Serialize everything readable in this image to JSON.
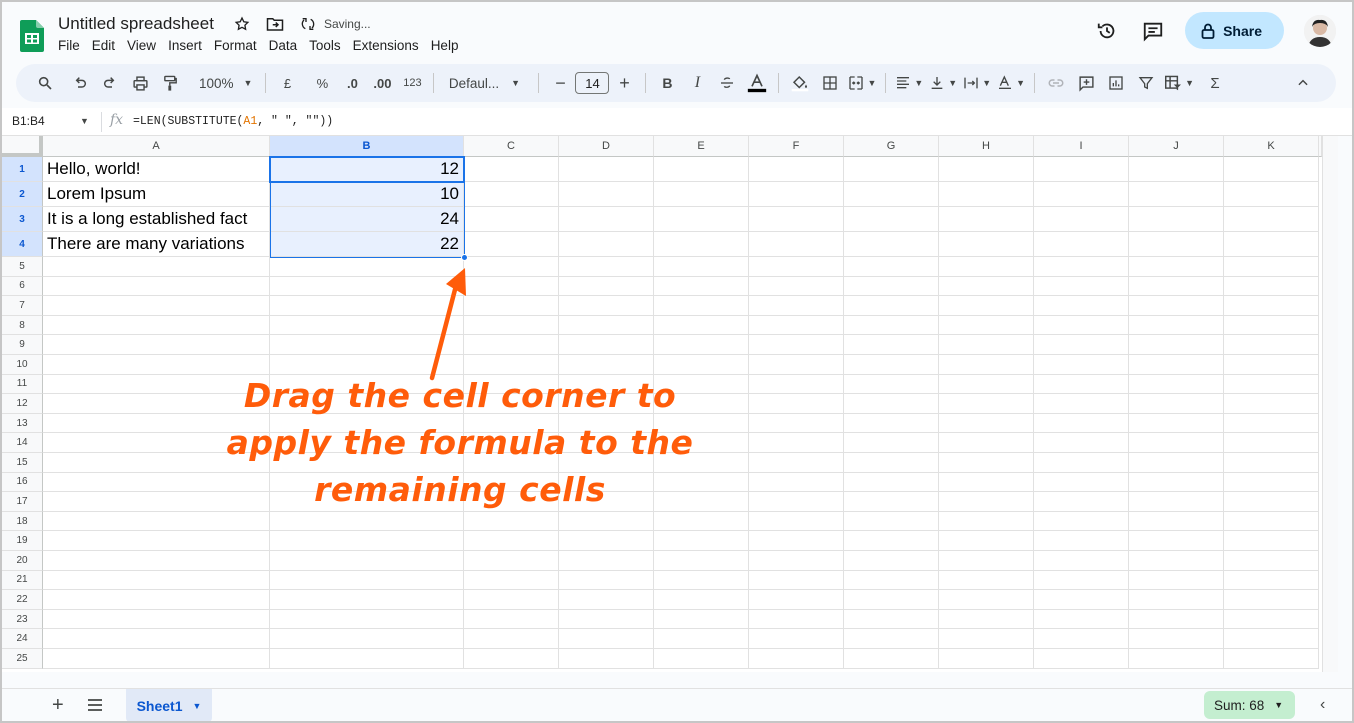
{
  "doc": {
    "title": "Untitled spreadsheet",
    "status": "Saving..."
  },
  "menu": [
    "File",
    "Edit",
    "View",
    "Insert",
    "Format",
    "Data",
    "Tools",
    "Extensions",
    "Help"
  ],
  "header": {
    "share_label": "Share"
  },
  "toolbar": {
    "zoom": "100%",
    "currency": "£",
    "percent": "%",
    "dec_decrease": ".0",
    "dec_increase": ".00",
    "number_format": "123",
    "font": "Defaul...",
    "font_size": "14",
    "bold": "B",
    "italic": "I",
    "sum_symbol": "Σ"
  },
  "formula_bar": {
    "name_box": "B1:B4",
    "fx": "fx",
    "formula_prefix": "=LEN(SUBSTITUTE(",
    "formula_ref": "A1",
    "formula_suffix": ", \" \", \"\"))"
  },
  "grid": {
    "columns": [
      "A",
      "B",
      "C",
      "D",
      "E",
      "F",
      "G",
      "H",
      "I",
      "J",
      "K"
    ],
    "rows": [
      "1",
      "2",
      "3",
      "4",
      "5",
      "6",
      "7",
      "8",
      "9",
      "10",
      "11",
      "12",
      "13",
      "14",
      "15",
      "16",
      "17",
      "18",
      "19",
      "20",
      "21",
      "22",
      "23",
      "24",
      "25"
    ],
    "cells": [
      {
        "a": "Hello, world!",
        "b": "12"
      },
      {
        "a": "Lorem Ipsum",
        "b": "10"
      },
      {
        "a": "It is a long established fact",
        "b": "24"
      },
      {
        "a": "There are many variations",
        "b": "22"
      }
    ]
  },
  "annotation": {
    "line1": "Drag the cell corner to",
    "line2": "apply the formula to the",
    "line3": "remaining cells",
    "color": "#ff5c0a"
  },
  "bottom": {
    "sheet_name": "Sheet1",
    "sum_label": "Sum: 68"
  },
  "colors": {
    "accent": "#1a73e8",
    "share_bg": "#c2e7ff",
    "toolbar_bg": "#edf2fa",
    "sum_bg": "#c4eed0"
  }
}
